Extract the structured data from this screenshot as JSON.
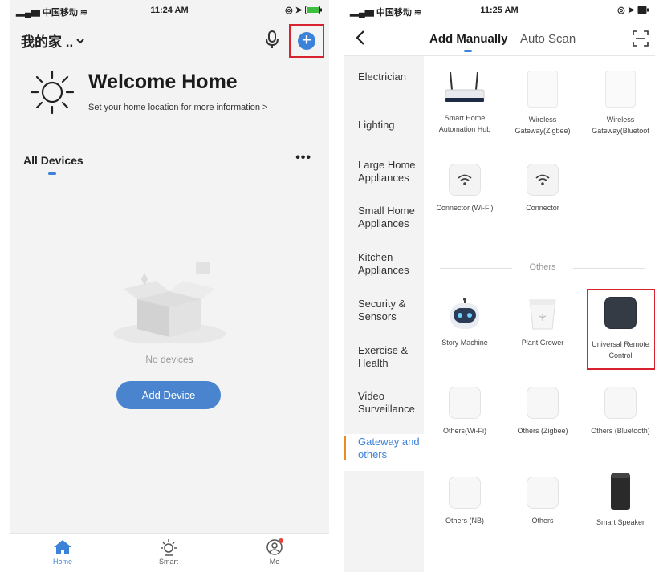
{
  "left": {
    "status": {
      "carrier": "中国移动",
      "time": "11:24 AM"
    },
    "header": {
      "home_name": "我的家 .."
    },
    "welcome": {
      "title": "Welcome Home",
      "subtitle": "Set your home location for more information >"
    },
    "devices": {
      "title": "All Devices",
      "more": "•••",
      "empty_text": "No devices",
      "add_button": "Add Device"
    },
    "tabbar": {
      "home": "Home",
      "smart": "Smart",
      "me": "Me"
    },
    "colors": {
      "accent": "#3b82d8",
      "button": "#4a84cf",
      "highlight": "#d6232e",
      "badge": "#e9453b"
    }
  },
  "right": {
    "status": {
      "carrier": "中国移动",
      "time": "11:25 AM"
    },
    "header": {
      "tab_manual": "Add Manually",
      "tab_auto": "Auto Scan"
    },
    "categories": [
      {
        "label": "Electrician",
        "active": false
      },
      {
        "label": "Lighting",
        "active": false
      },
      {
        "label": "Large Home Appliances",
        "active": false
      },
      {
        "label": "Small Home Appliances",
        "active": false
      },
      {
        "label": "Kitchen Appliances",
        "active": false
      },
      {
        "label": "Security & Sensors",
        "active": false
      },
      {
        "label": "Exercise & Health",
        "active": false
      },
      {
        "label": "Video Surveillance",
        "active": false
      },
      {
        "label": "Gateway and others",
        "active": true
      }
    ],
    "products": {
      "hub": "Smart Home Automation Hub",
      "gw_zigbee": "Wireless Gateway(Zigbee)",
      "gw_bt": "Wireless Gateway(Bluetoot",
      "conn_wifi": "Connector (Wi-Fi)",
      "conn": "Connector",
      "others_heading": "Others",
      "story": "Story Machine",
      "plant": "Plant Grower",
      "remote": "Universal Remote Control",
      "others_wifi": "Others(Wi-Fi)",
      "others_zigbee": "Others (Zigbee)",
      "others_bt": "Others (Bluetooth)",
      "others_nb": "Others (NB)",
      "others": "Others",
      "speaker": "Smart Speaker"
    }
  }
}
